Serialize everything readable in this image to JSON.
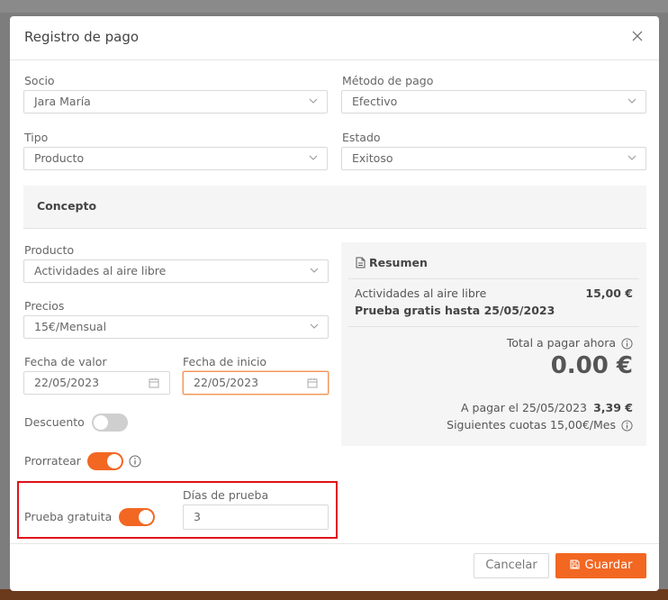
{
  "modal": {
    "title": "Registro de pago"
  },
  "fields": {
    "socio": {
      "label": "Socio",
      "value": "Jara María"
    },
    "metodo": {
      "label": "Método de pago",
      "value": "Efectivo"
    },
    "tipo": {
      "label": "Tipo",
      "value": "Producto"
    },
    "estado": {
      "label": "Estado",
      "value": "Exitoso"
    }
  },
  "concepto": {
    "title": "Concepto"
  },
  "producto": {
    "label": "Producto",
    "value": "Actividades al aire libre"
  },
  "precios": {
    "label": "Precios",
    "value": "15€/Mensual"
  },
  "fecha_valor": {
    "label": "Fecha de valor",
    "value": "22/05/2023"
  },
  "fecha_inicio": {
    "label": "Fecha de inicio",
    "value": "22/05/2023"
  },
  "descuento": {
    "label": "Descuento",
    "enabled": false
  },
  "prorratear": {
    "label": "Prorratear",
    "enabled": true
  },
  "prueba": {
    "label": "Prueba gratuita",
    "enabled": true
  },
  "dias_prueba": {
    "label": "Días de prueba",
    "value": "3"
  },
  "resumen": {
    "title": "Resumen",
    "item_name": "Actividades al aire libre",
    "item_price": "15,00 €",
    "trial_note": "Prueba gratis hasta 25/05/2023",
    "total_label": "Total a pagar ahora",
    "total_value": "0.00 €",
    "pay_date_label": "A pagar el 25/05/2023",
    "pay_date_value": "3,39 €",
    "next_fees": "Siguientes cuotas 15,00€/Mes"
  },
  "footer": {
    "cancel": "Cancelar",
    "save": "Guardar"
  },
  "colors": {
    "accent": "#f26722",
    "highlight": "#e0121a"
  }
}
